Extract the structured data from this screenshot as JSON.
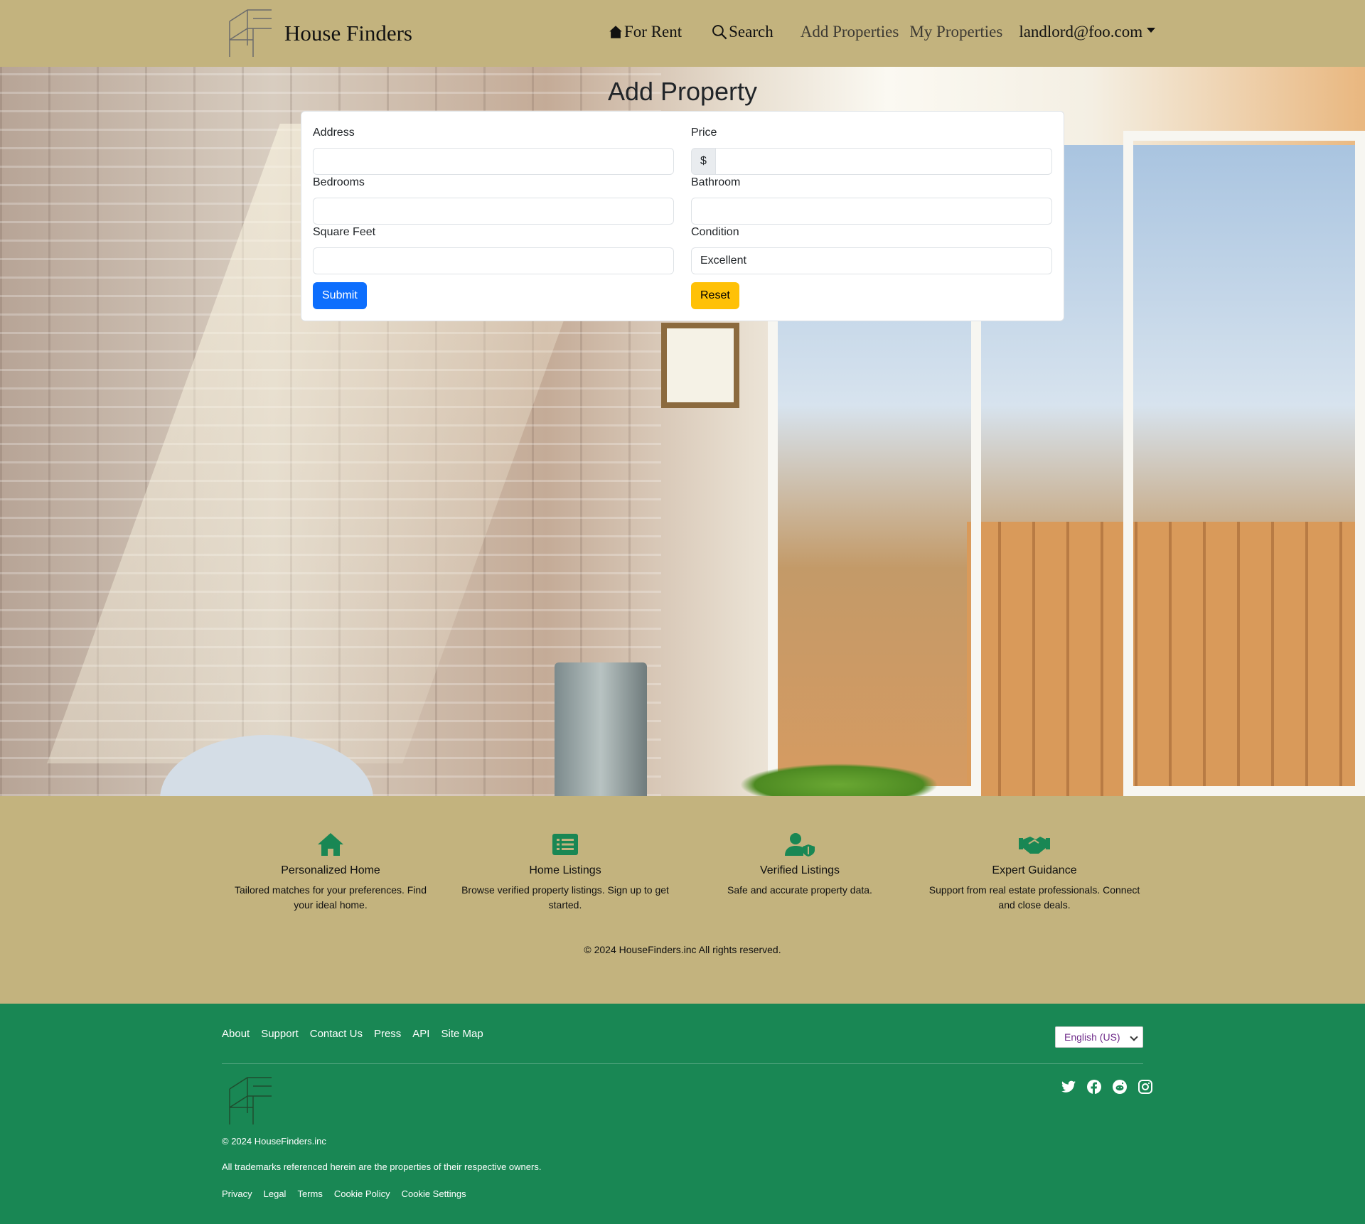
{
  "brand": {
    "name": "House Finders",
    "logo": "hf-logo-icon"
  },
  "nav": {
    "for_rent": "For Rent",
    "search": "Search",
    "add_properties": "Add Properties",
    "my_properties": "My Properties",
    "user": "landlord@foo.com"
  },
  "page": {
    "title": "Add Property"
  },
  "form": {
    "address_label": "Address",
    "address_value": "",
    "price_label": "Price",
    "price_prefix": "$",
    "price_value": "",
    "bedrooms_label": "Bedrooms",
    "bedrooms_value": "",
    "bathroom_label": "Bathroom",
    "bathroom_value": "",
    "sqft_label": "Square Feet",
    "sqft_value": "",
    "condition_label": "Condition",
    "condition_value": "Excellent",
    "submit_label": "Submit",
    "reset_label": "Reset"
  },
  "features": [
    {
      "icon": "house-icon",
      "title": "Personalized Home",
      "text": "Tailored matches for your preferences. Find your ideal home."
    },
    {
      "icon": "list-icon",
      "title": "Home Listings",
      "text": "Browse verified property listings. Sign up to get started."
    },
    {
      "icon": "user-shield-icon",
      "title": "Verified Listings",
      "text": "Safe and accurate property data."
    },
    {
      "icon": "handshake-icon",
      "title": "Expert Guidance",
      "text": "Support from real estate professionals. Connect and close deals."
    }
  ],
  "copyright": "© 2024 HouseFinders.inc All rights reserved.",
  "footer": {
    "links": [
      "About",
      "Support",
      "Contact Us",
      "Press",
      "API",
      "Site Map"
    ],
    "language": "English (US)",
    "social": [
      "twitter-icon",
      "facebook-icon",
      "reddit-icon",
      "instagram-icon"
    ],
    "copyright": "© 2024 HouseFinders.inc",
    "trademark": "All trademarks referenced herein are the properties of their respective owners.",
    "legal": [
      "Privacy",
      "Legal",
      "Terms",
      "Cookie Policy",
      "Cookie Settings"
    ]
  },
  "colors": {
    "navbar_bg": "#c3b37e",
    "footer_bg": "#198754",
    "icon_green": "#198754",
    "primary": "#0d6efd",
    "warning": "#ffc107"
  }
}
